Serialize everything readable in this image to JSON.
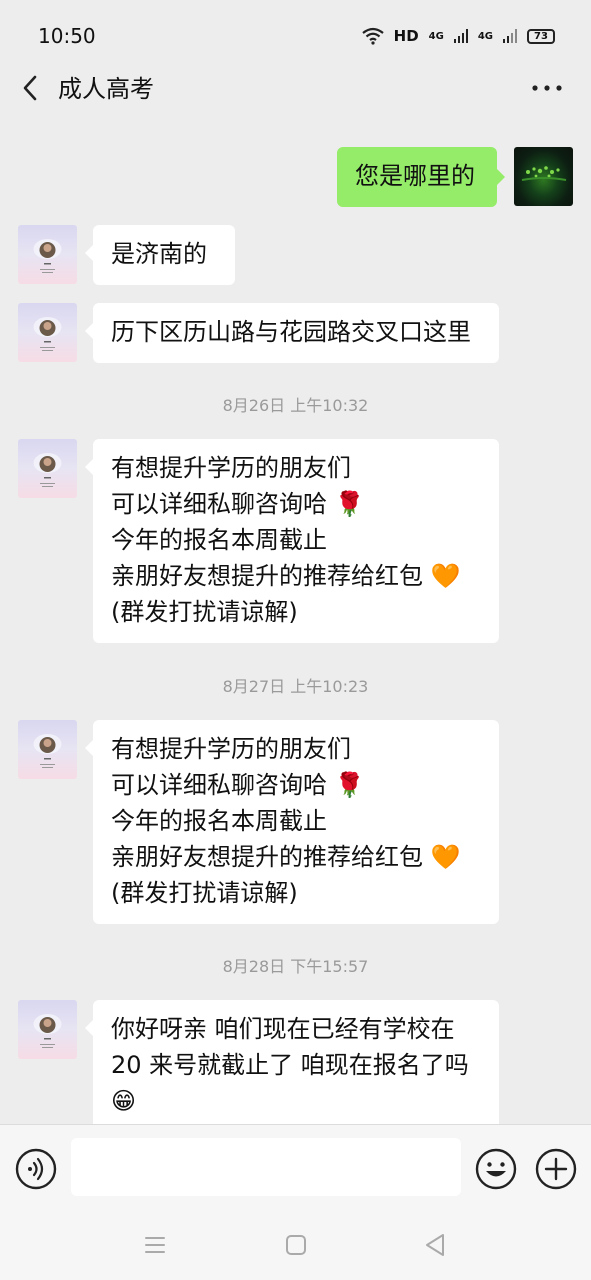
{
  "status": {
    "time": "10:50",
    "hd": "HD",
    "net1": "4G",
    "net2": "4G",
    "battery": "73"
  },
  "header": {
    "title": "成人高考",
    "back_icon": "chevron-left-icon",
    "more_icon": "more-dots-icon"
  },
  "messages": [
    {
      "side": "out",
      "text": "您是哪里的"
    },
    {
      "side": "in",
      "text": "是济南的"
    },
    {
      "side": "in",
      "text": "历下区历山路与花园路交叉口这里"
    },
    {
      "time": "8月26日 上午10:32"
    },
    {
      "side": "in",
      "text": "有想提升学历的朋友们\n可以详细私聊咨询哈 🌹\n今年的报名本周截止\n亲朋好友想提升的推荐给红包 🧡\n(群发打扰请谅解)"
    },
    {
      "time": "8月27日 上午10:23"
    },
    {
      "side": "in",
      "text": "有想提升学历的朋友们\n可以详细私聊咨询哈 🌹\n今年的报名本周截止\n亲朋好友想提升的推荐给红包 🧡\n(群发打扰请谅解)"
    },
    {
      "time": "8月28日 下午15:57"
    },
    {
      "side": "in",
      "text": "你好呀亲  咱们现在已经有学校在\n20 来号就截止了 咱现在报名了吗\n😁"
    }
  ],
  "input": {
    "value": "",
    "placeholder": ""
  },
  "icons": {
    "voice": "voice-icon",
    "emoji": "emoji-icon",
    "plus": "plus-icon",
    "nav_menu": "menu-icon",
    "nav_home": "home-icon",
    "nav_back": "back-triangle-icon"
  },
  "colors": {
    "background": "#ededed",
    "bubble_out": "#95ec69",
    "bubble_in": "#ffffff",
    "timestamp": "#9a9a9a"
  }
}
